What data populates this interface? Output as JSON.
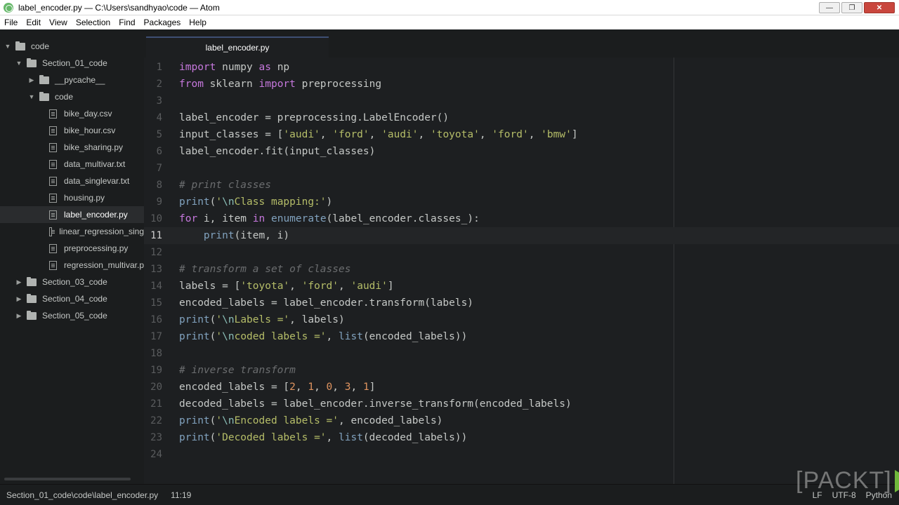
{
  "window": {
    "title": "label_encoder.py — C:\\Users\\sandhyao\\code — Atom"
  },
  "menu": [
    "File",
    "Edit",
    "View",
    "Selection",
    "Find",
    "Packages",
    "Help"
  ],
  "tree": [
    {
      "label": "code",
      "type": "folder",
      "expanded": true,
      "depth": 0
    },
    {
      "label": "Section_01_code",
      "type": "folder",
      "expanded": true,
      "depth": 1
    },
    {
      "label": "__pycache__",
      "type": "folder",
      "expanded": false,
      "depth": 2
    },
    {
      "label": "code",
      "type": "folder",
      "expanded": true,
      "depth": 2
    },
    {
      "label": "bike_day.csv",
      "type": "file",
      "depth": 3
    },
    {
      "label": "bike_hour.csv",
      "type": "file",
      "depth": 3
    },
    {
      "label": "bike_sharing.py",
      "type": "file",
      "depth": 3
    },
    {
      "label": "data_multivar.txt",
      "type": "file",
      "depth": 3
    },
    {
      "label": "data_singlevar.txt",
      "type": "file",
      "depth": 3
    },
    {
      "label": "housing.py",
      "type": "file",
      "depth": 3
    },
    {
      "label": "label_encoder.py",
      "type": "file",
      "depth": 3,
      "selected": true
    },
    {
      "label": "linear_regression_sing",
      "type": "file",
      "depth": 3
    },
    {
      "label": "preprocessing.py",
      "type": "file",
      "depth": 3
    },
    {
      "label": "regression_multivar.p",
      "type": "file",
      "depth": 3
    },
    {
      "label": "Section_03_code",
      "type": "folder",
      "expanded": false,
      "depth": 1
    },
    {
      "label": "Section_04_code",
      "type": "folder",
      "expanded": false,
      "depth": 1
    },
    {
      "label": "Section_05_code",
      "type": "folder",
      "expanded": false,
      "depth": 1
    }
  ],
  "tab": {
    "label": "label_encoder.py"
  },
  "editor": {
    "current_line": 11,
    "lines": [
      [
        [
          "kw",
          "import"
        ],
        [
          "t",
          " numpy "
        ],
        [
          "kw",
          "as"
        ],
        [
          "t",
          " np"
        ]
      ],
      [
        [
          "kw",
          "from"
        ],
        [
          "t",
          " sklearn "
        ],
        [
          "kw",
          "import"
        ],
        [
          "t",
          " preprocessing"
        ]
      ],
      [],
      [
        [
          "t",
          "label_encoder = preprocessing.LabelEncoder()"
        ]
      ],
      [
        [
          "t",
          "input_classes = ["
        ],
        [
          "str",
          "'audi'"
        ],
        [
          "t",
          ", "
        ],
        [
          "str",
          "'ford'"
        ],
        [
          "t",
          ", "
        ],
        [
          "str",
          "'audi'"
        ],
        [
          "t",
          ", "
        ],
        [
          "str",
          "'toyota'"
        ],
        [
          "t",
          ", "
        ],
        [
          "str",
          "'ford'"
        ],
        [
          "t",
          ", "
        ],
        [
          "str",
          "'bmw'"
        ],
        [
          "t",
          "]"
        ]
      ],
      [
        [
          "t",
          "label_encoder.fit(input_classes)"
        ]
      ],
      [],
      [
        [
          "com",
          "# print classes"
        ]
      ],
      [
        [
          "fn",
          "print"
        ],
        [
          "t",
          "("
        ],
        [
          "str",
          "'"
        ],
        [
          "esc",
          "\\n"
        ],
        [
          "str",
          "Class mapping:'"
        ],
        [
          "t",
          ")"
        ]
      ],
      [
        [
          "kw",
          "for"
        ],
        [
          "t",
          " i, item "
        ],
        [
          "kw",
          "in"
        ],
        [
          "t",
          " "
        ],
        [
          "fn",
          "enumerate"
        ],
        [
          "t",
          "(label_encoder.classes_):"
        ]
      ],
      [
        [
          "t",
          "    "
        ],
        [
          "fn",
          "print"
        ],
        [
          "t",
          "(item, i)"
        ]
      ],
      [],
      [
        [
          "com",
          "# transform a set of classes"
        ]
      ],
      [
        [
          "t",
          "labels = ["
        ],
        [
          "str",
          "'toyota'"
        ],
        [
          "t",
          ", "
        ],
        [
          "str",
          "'ford'"
        ],
        [
          "t",
          ", "
        ],
        [
          "str",
          "'audi'"
        ],
        [
          "t",
          "]"
        ]
      ],
      [
        [
          "t",
          "encoded_labels = label_encoder.transform(labels)"
        ]
      ],
      [
        [
          "fn",
          "print"
        ],
        [
          "t",
          "("
        ],
        [
          "str",
          "'"
        ],
        [
          "esc",
          "\\n"
        ],
        [
          "str",
          "Labels ='"
        ],
        [
          "t",
          ", labels)"
        ]
      ],
      [
        [
          "fn",
          "print"
        ],
        [
          "t",
          "("
        ],
        [
          "str",
          "'"
        ],
        [
          "esc",
          "\\n"
        ],
        [
          "str",
          "coded labels ='"
        ],
        [
          "t",
          ", "
        ],
        [
          "fn",
          "list"
        ],
        [
          "t",
          "(encoded_labels))"
        ]
      ],
      [],
      [
        [
          "com",
          "# inverse transform"
        ]
      ],
      [
        [
          "t",
          "encoded_labels = ["
        ],
        [
          "num",
          "2"
        ],
        [
          "t",
          ", "
        ],
        [
          "num",
          "1"
        ],
        [
          "t",
          ", "
        ],
        [
          "num",
          "0"
        ],
        [
          "t",
          ", "
        ],
        [
          "num",
          "3"
        ],
        [
          "t",
          ", "
        ],
        [
          "num",
          "1"
        ],
        [
          "t",
          "]"
        ]
      ],
      [
        [
          "t",
          "decoded_labels = label_encoder.inverse_transform(encoded_labels)"
        ]
      ],
      [
        [
          "fn",
          "print"
        ],
        [
          "t",
          "("
        ],
        [
          "str",
          "'"
        ],
        [
          "esc",
          "\\n"
        ],
        [
          "str",
          "Encoded labels ='"
        ],
        [
          "t",
          ", encoded_labels)"
        ]
      ],
      [
        [
          "fn",
          "print"
        ],
        [
          "t",
          "("
        ],
        [
          "str",
          "'Decoded labels ='"
        ],
        [
          "t",
          ", "
        ],
        [
          "fn",
          "list"
        ],
        [
          "t",
          "(decoded_labels))"
        ]
      ],
      []
    ]
  },
  "status": {
    "path": "Section_01_code\\code\\label_encoder.py",
    "cursor": "11:19",
    "line_ending": "LF",
    "encoding": "UTF-8",
    "grammar": "Python"
  },
  "watermark": {
    "text": "[PACKT]"
  }
}
